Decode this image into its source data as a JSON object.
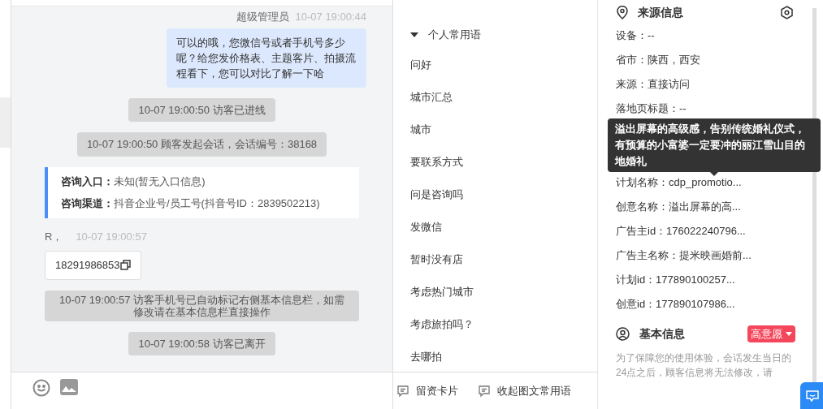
{
  "chat": {
    "messages": [
      {
        "kind": "agent",
        "sender": "超级管理员",
        "time": "10-07 19:00:44",
        "text": "可以的哦，您微信号或者手机号多少呢？给您发价格表、主题客片、拍摄流程看下，您可以对比了解一下哈"
      },
      {
        "kind": "system",
        "text": "10-07 19:00:50 访客已进线"
      },
      {
        "kind": "system",
        "text": "10-07 19:00:50 顾客发起会话，会话编号：38168"
      },
      {
        "kind": "info",
        "rows": [
          {
            "label": "咨询入口：",
            "value": "未知(暂无入口信息)"
          },
          {
            "label": "咨询渠道：",
            "value": "抖音企业号/员工号(抖音号ID：2839502213)"
          }
        ]
      },
      {
        "kind": "visitor",
        "sender": "R，",
        "time": "10-07 19:00:57",
        "text": "18291986853"
      },
      {
        "kind": "notice",
        "text": "10-07 19:00:57 访客手机号已自动标记右侧基本信息栏，如需修改请在基本信息栏直接操作"
      },
      {
        "kind": "system",
        "text": "10-07 19:00:58 访客已离开"
      }
    ]
  },
  "phrases": {
    "group": "个人常用语",
    "expanded": true,
    "items": [
      "问好",
      "城市汇总",
      "城市",
      "要联系方式",
      "问是咨询吗",
      "发微信",
      "暂时没有店",
      "考虑热门城市",
      "考虑旅拍吗？",
      "去哪拍"
    ],
    "actions": [
      "留资卡片",
      "收起图文常用语"
    ]
  },
  "source": {
    "title": "来源信息",
    "fields": [
      "设备：--",
      "省市：陕西，西安",
      "来源：直接访问",
      "落地页标题：--",
      "计划名称：cdp_promotio...",
      "创意名称：溢出屏幕的高...",
      "广告主id：176022240796...",
      "广告主名称：提米映画婚前...",
      "计划id：177890100257...",
      "创意id：177890107986..."
    ],
    "tooltip": "溢出屏幕的高级感，告别传统婚礼仪式，有预算的小富婆一定要冲的丽江雪山目的地婚礼"
  },
  "basic": {
    "title": "基本信息",
    "intent": "高意愿",
    "note": "为了保障您的使用体验，会话发生当日的24点之后，顾客信息将无法修改，请"
  }
}
